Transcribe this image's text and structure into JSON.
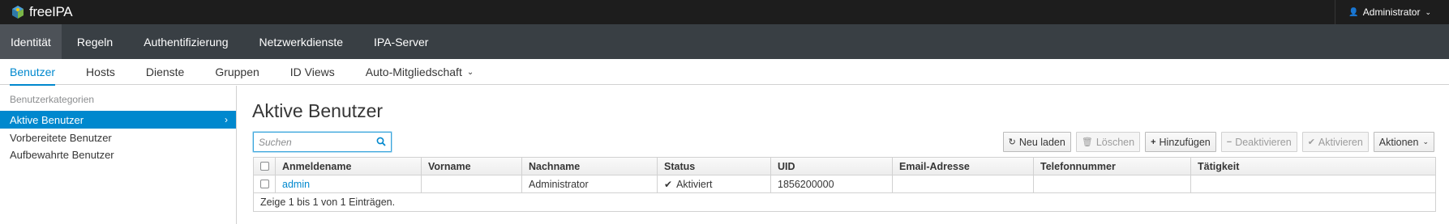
{
  "app": {
    "brand": "freeIPA",
    "user": "Administrator"
  },
  "primary_nav": [
    {
      "label": "Identität",
      "active": true
    },
    {
      "label": "Regeln"
    },
    {
      "label": "Authentifizierung"
    },
    {
      "label": "Netzwerkdienste"
    },
    {
      "label": "IPA-Server"
    }
  ],
  "secondary_nav": [
    {
      "label": "Benutzer",
      "active": true
    },
    {
      "label": "Hosts"
    },
    {
      "label": "Dienste"
    },
    {
      "label": "Gruppen"
    },
    {
      "label": "ID Views"
    },
    {
      "label": "Auto-Mitgliedschaft"
    }
  ],
  "sidebar": {
    "heading": "Benutzerkategorien",
    "items": [
      {
        "label": "Aktive Benutzer",
        "active": true
      },
      {
        "label": "Vorbereitete Benutzer"
      },
      {
        "label": "Aufbewahrte Benutzer"
      }
    ]
  },
  "main": {
    "title": "Aktive Benutzer",
    "search": {
      "placeholder": "Suchen",
      "value": ""
    },
    "toolbar": {
      "reload": "Neu laden",
      "delete": "Löschen",
      "add": "Hinzufügen",
      "deactivate": "Deaktivieren",
      "activate": "Aktivieren",
      "actions": "Aktionen"
    },
    "table": {
      "columns": [
        "Anmeldename",
        "Vorname",
        "Nachname",
        "Status",
        "UID",
        "Email-Adresse",
        "Telefonnummer",
        "Tätigkeit"
      ],
      "rows": [
        {
          "login": "admin",
          "first": "",
          "last": "Administrator",
          "status": "Aktiviert",
          "uid": "1856200000",
          "email": "",
          "phone": "",
          "job": ""
        }
      ],
      "footer": "Zeige 1 bis 1 von 1 Einträgen."
    }
  },
  "colors": {
    "accent": "#0088ce",
    "topbar": "#1d1d1d",
    "primary_nav": "#393f44"
  }
}
